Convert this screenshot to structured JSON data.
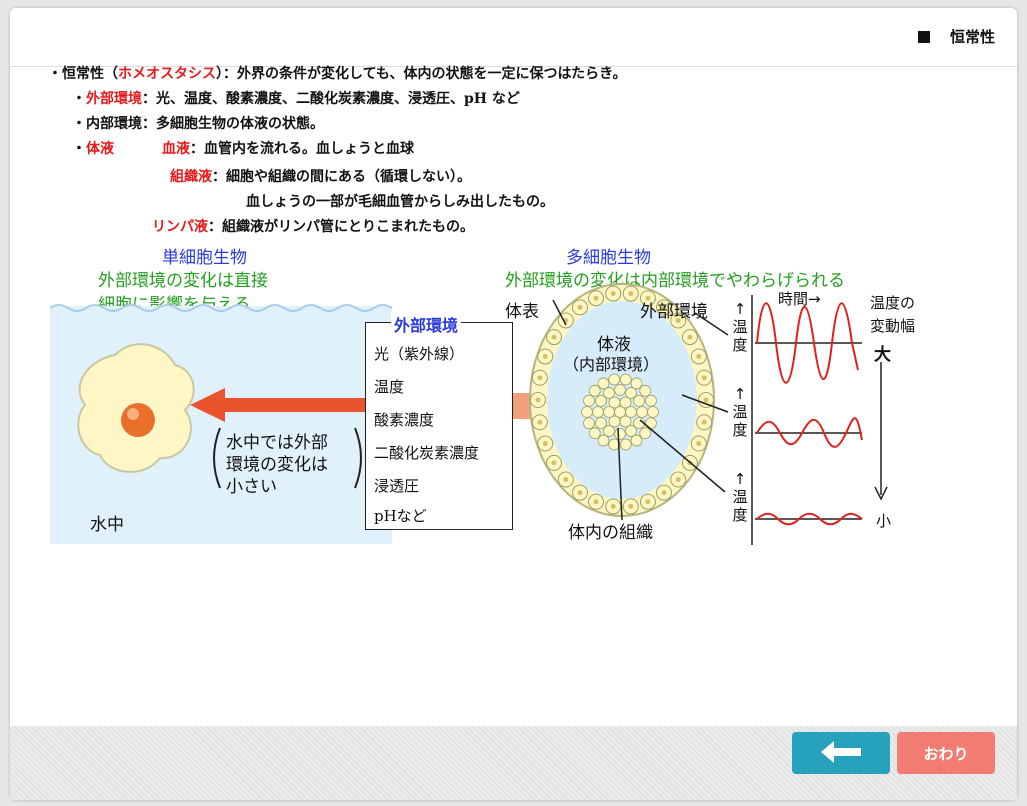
{
  "header": {
    "title": "恒常性"
  },
  "lines": {
    "l1_a": "・恒常性（",
    "l1_red": "ホメオスタシス",
    "l1_b": "）：外界の条件が変化しても、体内の状態を一定に保つはたらき。",
    "l2_bullet": "・",
    "l2_red": "外部環境",
    "l2_text": "：光、温度、酸素濃度、二酸化炭素濃度、浸透圧、pH など",
    "l3_text": "・内部環境：多細胞生物の体液の状態。",
    "l4_bullet": "・",
    "l4_red": "体液",
    "l4_red2": "血液",
    "l4_text": "：血管内を流れる。血しょうと血球",
    "l5_red": "組織液",
    "l5_text": "：細胞や組織の間にある（循環しない）。",
    "l6_text": "血しょうの一部が毛細血管からしみ出したもの。",
    "l7_red": "リンパ液",
    "l7_text": "：組織液がリンパ管にとりこまれたもの。"
  },
  "diagram": {
    "unicell_title": "単細胞生物",
    "unicell_sub1": "外部環境の変化は直接",
    "unicell_sub2": "細胞に影響を与える",
    "multicell_title": "多細胞生物",
    "multicell_sub": "外部環境の変化は内部環境でやわらげられる",
    "water_label": "水中",
    "water_note1": "水中では外部",
    "water_note2": "環境の変化は",
    "water_note3": "小さい",
    "env_title": "外部環境",
    "env_items": [
      "光（紫外線）",
      "温度",
      "酸素濃度",
      "二酸化炭素濃度",
      "浸透圧",
      "pHなど"
    ],
    "body_surface": "体表",
    "body_fluid": "体液",
    "internal_env": "（内部環境）",
    "tissue": "体内の組織",
    "ext_env_label": "外部環境",
    "time_label": "時間→",
    "range_label1": "温度の",
    "range_label2": "変動幅",
    "large": "大",
    "small": "小",
    "temp_axis": "↑温度"
  },
  "footer": {
    "end_label": "おわり"
  },
  "colors": {
    "accent_red": "#e8181a",
    "blue": "#2a3bdc",
    "green": "#23a01e",
    "back": "#27a2bd",
    "end": "#f07c74"
  }
}
